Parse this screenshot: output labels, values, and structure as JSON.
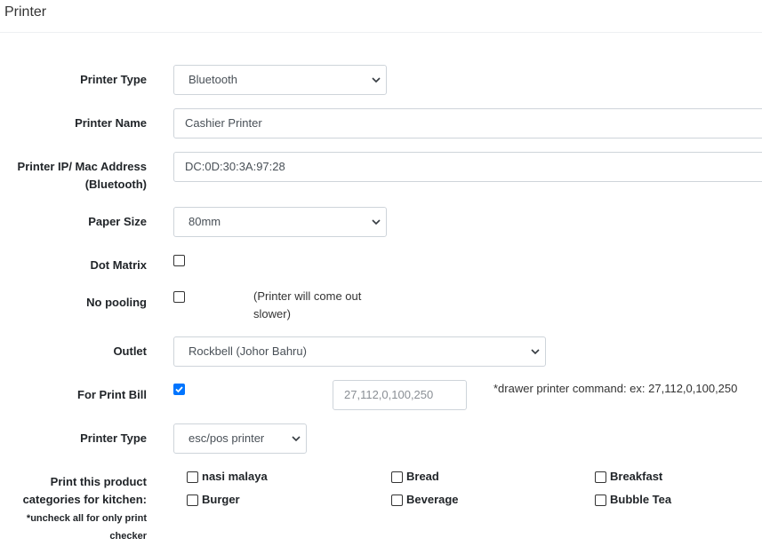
{
  "page": {
    "title": "Printer"
  },
  "form": {
    "printer_type_label": "Printer Type",
    "printer_type_value": "Bluetooth",
    "printer_name_label": "Printer Name",
    "printer_name_value": "Cashier Printer",
    "printer_ip_label_line1": "Printer IP/ Mac Address",
    "printer_ip_label_line2": "(Bluetooth)",
    "printer_ip_value": "DC:0D:30:3A:97:28",
    "paper_size_label": "Paper Size",
    "paper_size_value": "80mm",
    "dot_matrix_label": "Dot Matrix",
    "dot_matrix_checked": false,
    "no_pooling_label": "No pooling",
    "no_pooling_checked": false,
    "no_pooling_note_line1": "(Printer will come out",
    "no_pooling_note_line2": "slower)",
    "outlet_label": "Outlet",
    "outlet_value": "Rockbell (Johor Bahru)",
    "print_bill_label": "For Print Bill",
    "print_bill_checked": true,
    "drawer_command_placeholder": "27,112,0,100,250",
    "drawer_command_note": "*drawer printer command: ex: 27,112,0,100,250",
    "printer_type2_label": "Printer Type",
    "printer_type2_value": "esc/pos printer",
    "categories_label_line1": "Print this product",
    "categories_label_line2": "categories for kitchen:",
    "categories_note_line1": "*uncheck all for only print",
    "categories_note_line2": "checker",
    "categories": [
      {
        "label": "nasi malaya",
        "checked": false
      },
      {
        "label": "Bread",
        "checked": false
      },
      {
        "label": "Breakfast",
        "checked": false
      },
      {
        "label": "Burger",
        "checked": false
      },
      {
        "label": "Beverage",
        "checked": false
      },
      {
        "label": "Bubble Tea",
        "checked": false
      }
    ]
  },
  "colors": {
    "checkbox_checked": "#0075ff",
    "border": "#ced4da"
  },
  "icons": {
    "select_arrow": "chevron-down-icon",
    "checkmark": "checkmark-icon"
  }
}
